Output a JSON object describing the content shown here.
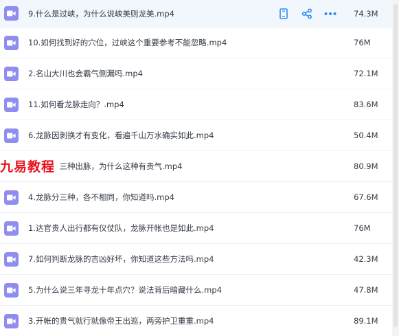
{
  "files": [
    {
      "name": "9.什么是过峡，为什么说峡美则龙美.mp4",
      "size": "74.3M"
    },
    {
      "name": "10.如何找到好的穴位，过峡这个重要参考不能忽略.mp4",
      "size": "76M"
    },
    {
      "name": "2.名山大川也会霸气侧漏吗.mp4",
      "size": "72.1M"
    },
    {
      "name": "11.如何看龙脉走向？.mp4",
      "size": "83.6M"
    },
    {
      "name": "6.龙脉因剥换才有变化，看遍千山万水确实如此.mp4",
      "size": "50.4M"
    },
    {
      "name": "8.出脉，三种出脉，为什么这种有贵气.mp4",
      "size": "80.9M"
    },
    {
      "name": "4.龙脉分三种，各不相同，你知道吗.mp4",
      "size": "67.6M"
    },
    {
      "name": "1.达官贵人出行都有仪仗队，龙脉开帐也是如此.mp4",
      "size": "76M"
    },
    {
      "name": "7.如何判断龙脉的吉凶好坏，你知道这些方法吗.mp4",
      "size": "42.3M"
    },
    {
      "name": "5.为什么说三年寻龙十年点穴？说法背后暗藏什么.mp4",
      "size": "47.8M"
    },
    {
      "name": "3.开帐的贵气就行就像帝王出巡，两旁护卫重重.mp4",
      "size": "89.1M"
    }
  ],
  "watermark": "九易教程",
  "icons": {
    "file": "video-file-icon",
    "row_actions": [
      "phone-icon",
      "share-icon",
      "more-icon"
    ]
  },
  "colors": {
    "file_icon": "#8f8ef0",
    "action_icon": "#2f8bf0",
    "watermark": "#e8121d",
    "hover_row": "#f2f6fd"
  }
}
